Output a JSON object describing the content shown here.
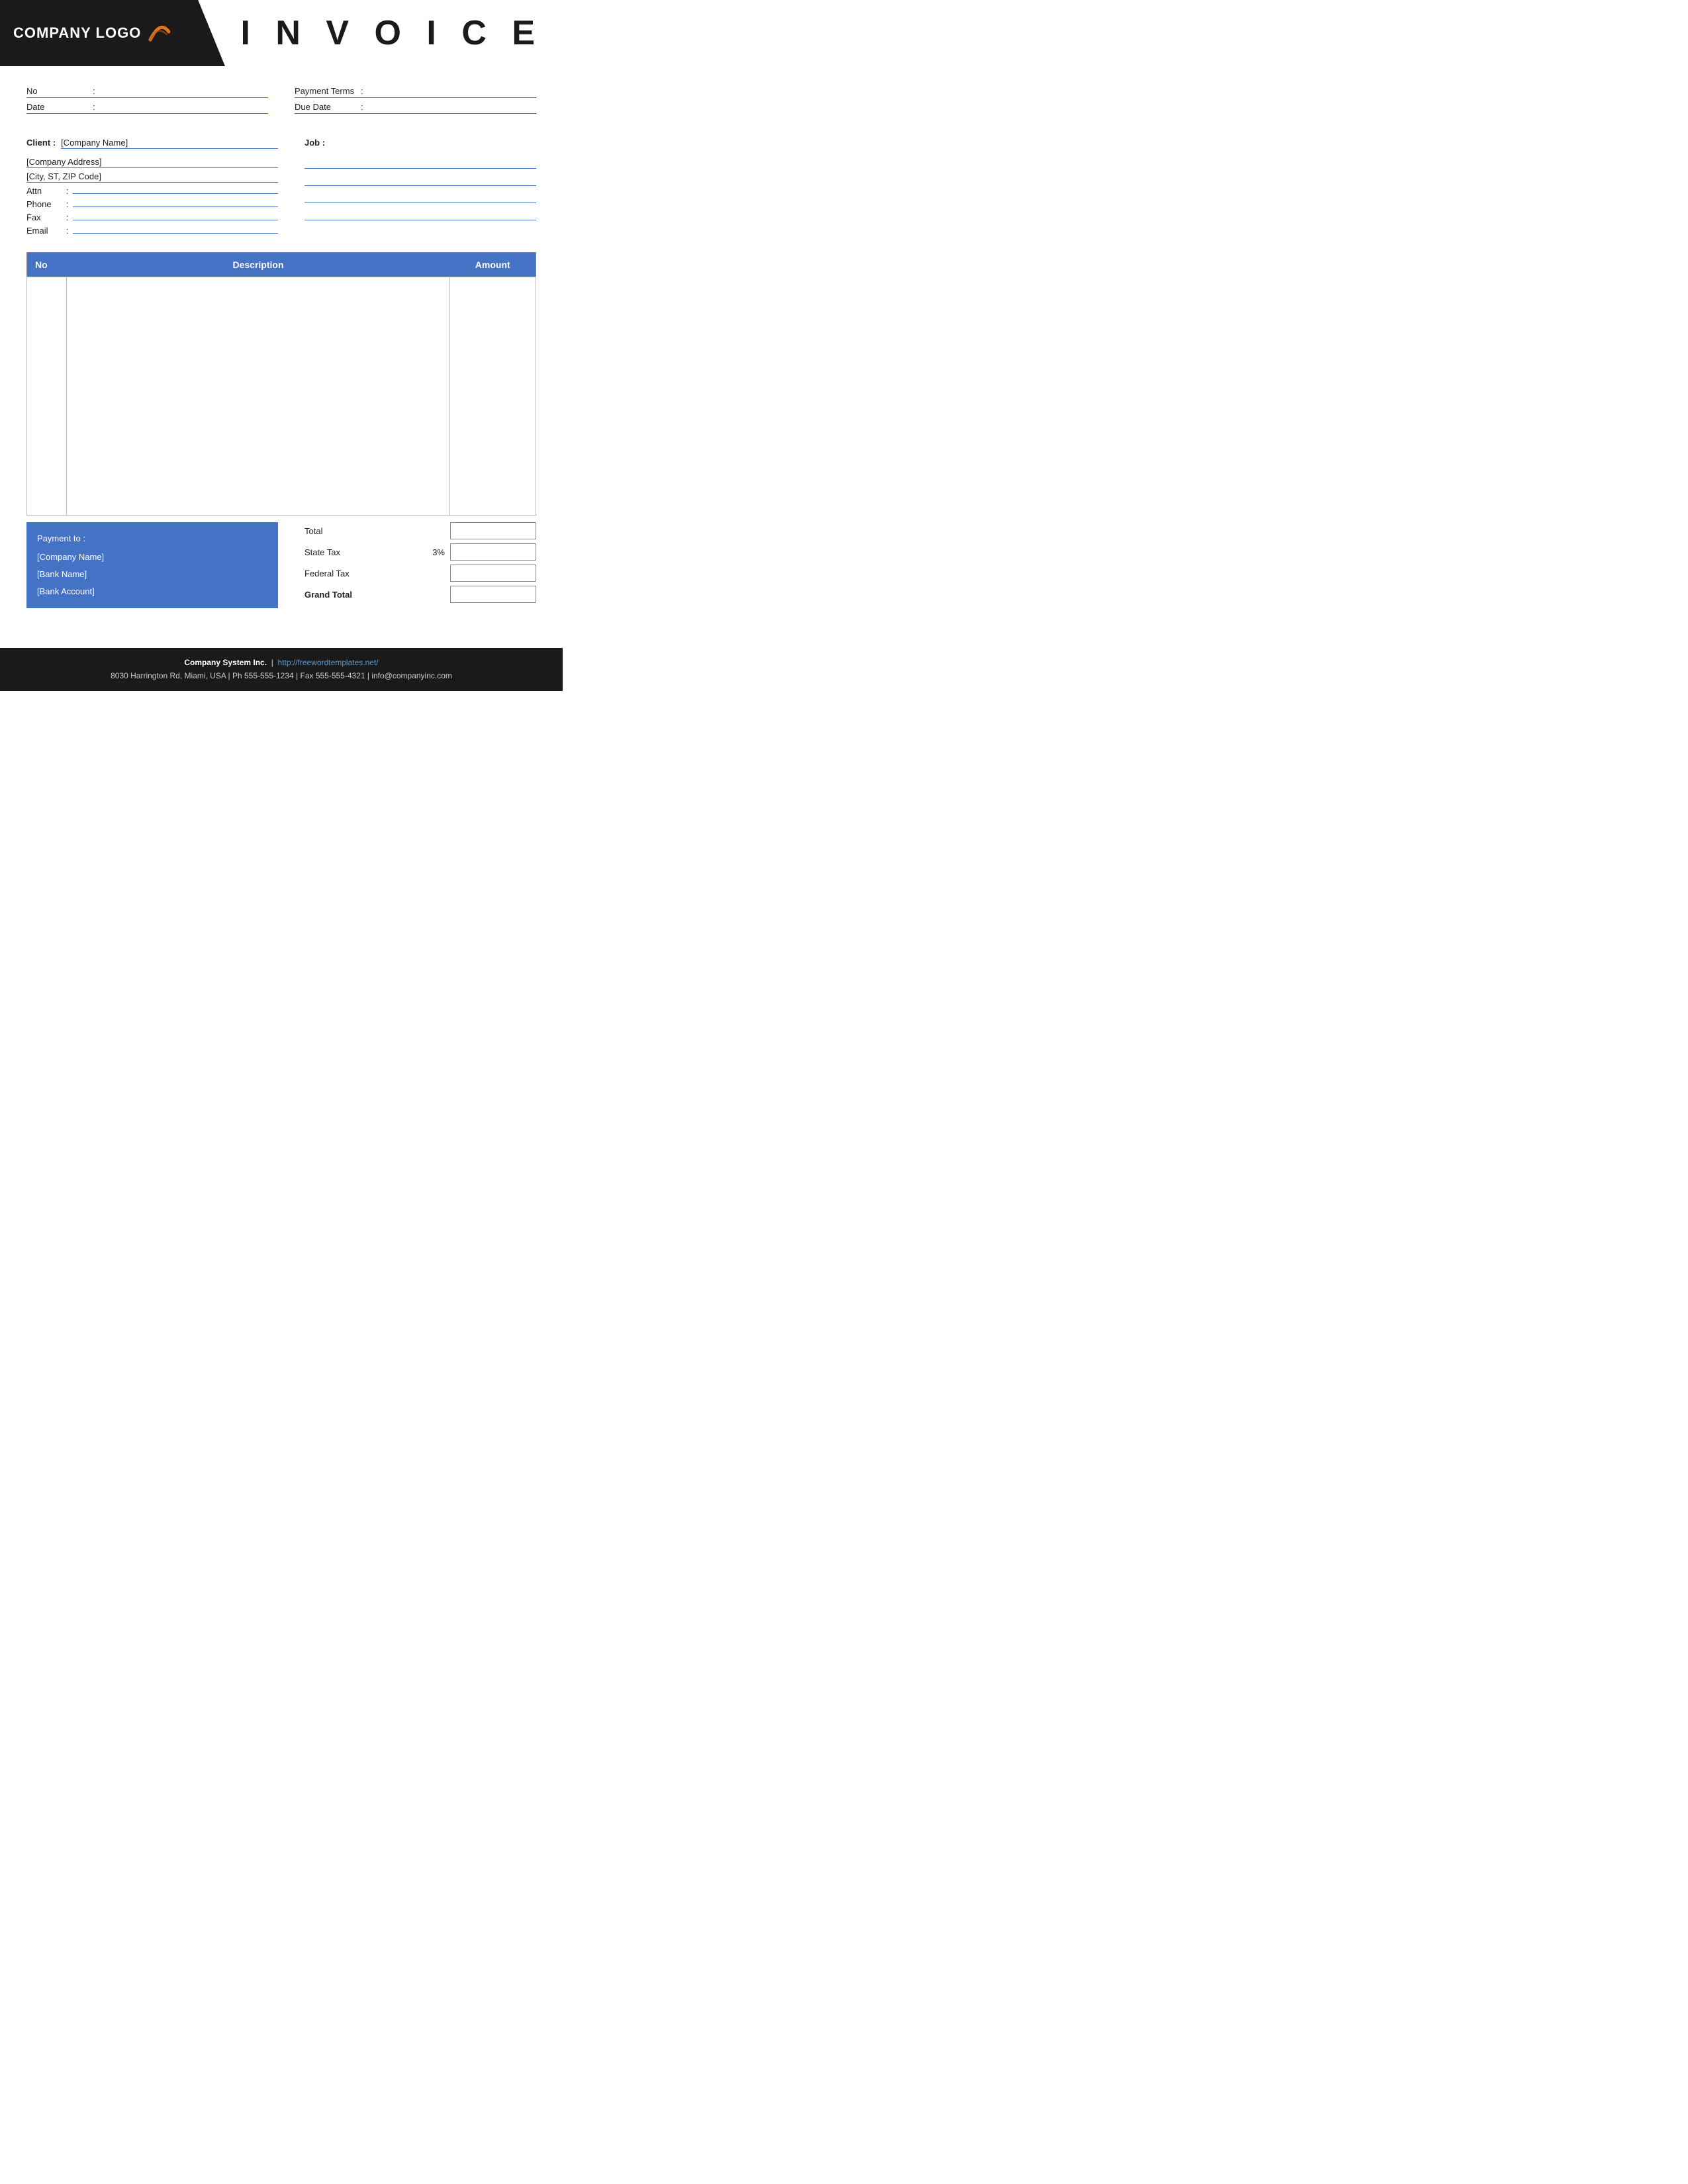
{
  "header": {
    "logo_text": "COMPANY LOGO",
    "invoice_title": "I N V O I C E"
  },
  "meta": {
    "no_label": "No",
    "no_colon": ":",
    "no_value": "",
    "payment_terms_label": "Payment  Terms",
    "payment_terms_colon": ":",
    "payment_terms_value": "",
    "date_label": "Date",
    "date_colon": ":",
    "date_value": "",
    "due_date_label": "Due Date",
    "due_date_colon": ":",
    "due_date_value": ""
  },
  "client": {
    "label": "Client :",
    "company_name": "[Company Name]",
    "company_address": "[Company Address]",
    "city_state_zip": "[City, ST, ZIP Code]",
    "attn_label": "Attn",
    "attn_colon": ":",
    "attn_value": "",
    "phone_label": "Phone",
    "phone_colon": ":",
    "phone_value": "",
    "fax_label": "Fax",
    "fax_colon": ":",
    "fax_value": "",
    "email_label": "Email",
    "email_colon": ":",
    "email_value": ""
  },
  "job": {
    "label": "Job :",
    "line1": "",
    "line2": "",
    "line3": "",
    "line4": ""
  },
  "table": {
    "col_no": "No",
    "col_description": "Description",
    "col_amount": "Amount"
  },
  "payment": {
    "label": "Payment to :",
    "company_name": "[Company Name]",
    "bank_name": "[Bank Name]",
    "bank_account": "[Bank Account]"
  },
  "totals": {
    "total_label": "Total",
    "total_value": "",
    "state_tax_label": "State Tax",
    "state_tax_pct": "3%",
    "state_tax_value": "",
    "federal_tax_label": "Federal Tax",
    "federal_tax_value": "",
    "grand_total_label": "Grand Total",
    "grand_total_value": ""
  },
  "footer": {
    "company_name": "Company System Inc.",
    "separator": "|",
    "website": "http://freewordtemplates.net/",
    "address": "8030 Harrington Rd, Miami, USA | Ph 555-555-1234 | Fax 555-555-4321 | info@companyinc.com"
  }
}
